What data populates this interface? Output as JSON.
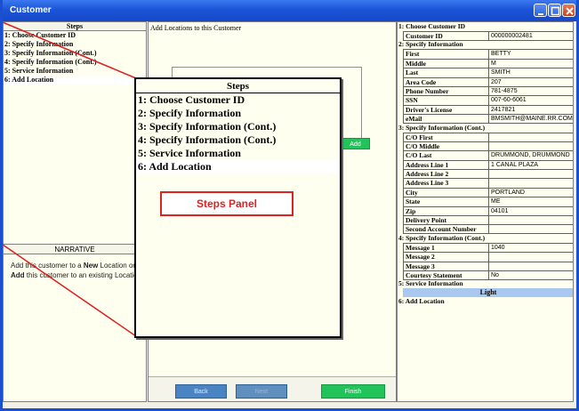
{
  "window": {
    "title": "Customer"
  },
  "steps": {
    "header": "Steps",
    "items": [
      "1: Choose Customer ID",
      "2: Specify Information",
      "3: Specify Information (Cont.)",
      "4: Specify Information (Cont.)",
      "5: Service Information",
      "6: Add Location"
    ]
  },
  "narrative": {
    "header": "NARRATIVE",
    "t1": "Add this customer to a ",
    "b1": "New",
    "t2": " Location or ",
    "b2": "Add",
    "t3": " this customer to an existing Location"
  },
  "main": {
    "title": "Add Locations to this Customer",
    "add_label": "Add",
    "back_label": "Back",
    "next_label": "Next",
    "finish_label": "Finish"
  },
  "callout": {
    "label": "Steps Panel"
  },
  "summary": {
    "s1": {
      "title": "1: Choose Customer ID",
      "rows": [
        {
          "label": "Customer ID",
          "value": "000000002481"
        }
      ]
    },
    "s2": {
      "title": "2: Specify Information",
      "rows": [
        {
          "label": "First",
          "value": "BETTY"
        },
        {
          "label": "Middle",
          "value": "M"
        },
        {
          "label": "Last",
          "value": "SMITH"
        },
        {
          "label": "Area Code",
          "value": "207"
        },
        {
          "label": "Phone Number",
          "value": "781-4875"
        },
        {
          "label": "SSN",
          "value": "007-60-6061"
        },
        {
          "label": "Driver's License",
          "value": "2417821"
        },
        {
          "label": "eMail",
          "value": "BMSMITH@MAINE.RR.COM"
        }
      ]
    },
    "s3": {
      "title": "3: Specify Information (Cont.)",
      "rows": [
        {
          "label": "C/O First",
          "value": ""
        },
        {
          "label": "C/O Middle",
          "value": ""
        },
        {
          "label": "C/O Last",
          "value": "DRUMMOND, DRUMMOND"
        },
        {
          "label": "Address Line 1",
          "value": "1 CANAL PLAZA"
        },
        {
          "label": "Address Line 2",
          "value": ""
        },
        {
          "label": "Address Line 3",
          "value": ""
        },
        {
          "label": "City",
          "value": "PORTLAND"
        },
        {
          "label": "State",
          "value": "ME"
        },
        {
          "label": "Zip",
          "value": "04101"
        },
        {
          "label": "Delivery Point",
          "value": ""
        },
        {
          "label": "Second Account Number",
          "value": ""
        }
      ]
    },
    "s4": {
      "title": "4: Specify Information (Cont.)",
      "rows": [
        {
          "label": "Message 1",
          "value": "1040"
        },
        {
          "label": "Message 2",
          "value": ""
        },
        {
          "label": "Message 3",
          "value": ""
        },
        {
          "label": "Courtesy Statement",
          "value": "No"
        }
      ]
    },
    "s5": {
      "title": "5: Service Information",
      "light": "Light"
    },
    "s6": {
      "title": "6: Add Location"
    }
  },
  "colors": {
    "titlebar": "#1b55d8",
    "accent_green": "#22c35a",
    "button_blue": "#4b84c2",
    "callout_red": "#dd2222",
    "highlight": "#a8c8f0"
  }
}
